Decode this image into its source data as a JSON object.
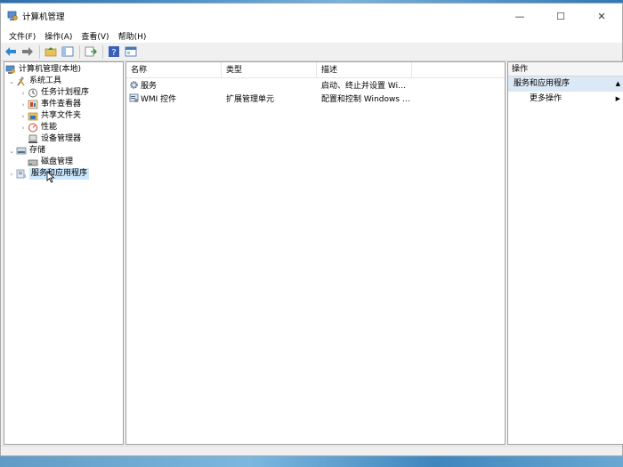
{
  "window": {
    "title": "计算机管理",
    "controls": {
      "minimize": "—",
      "maximize": "☐",
      "close": "✕"
    }
  },
  "menu": {
    "items": [
      {
        "label": "文件(F)"
      },
      {
        "label": "操作(A)"
      },
      {
        "label": "查看(V)"
      },
      {
        "label": "帮助(H)"
      }
    ]
  },
  "tree": {
    "items": [
      {
        "label": "计算机管理(本地)"
      },
      {
        "label": "系统工具"
      },
      {
        "label": "任务计划程序"
      },
      {
        "label": "事件查看器"
      },
      {
        "label": "共享文件夹"
      },
      {
        "label": "性能"
      },
      {
        "label": "设备管理器"
      },
      {
        "label": "存储"
      },
      {
        "label": "磁盘管理"
      },
      {
        "label": "服务和应用程序"
      }
    ],
    "arrows": {
      "expanded": "⌄",
      "collapsed": "›"
    }
  },
  "list": {
    "columns": [
      "名称",
      "类型",
      "描述"
    ],
    "rows": [
      {
        "name": "服务",
        "type": "",
        "description": "启动、终止并设置 Wind..."
      },
      {
        "name": "WMI 控件",
        "type": "扩展管理单元",
        "description": "配置和控制 Windows M..."
      }
    ]
  },
  "actions": {
    "header": "操作",
    "section": "服务和应用程序",
    "items": [
      {
        "label": "更多操作"
      }
    ],
    "up_arrow": "▲",
    "right_arrow": "▶"
  }
}
